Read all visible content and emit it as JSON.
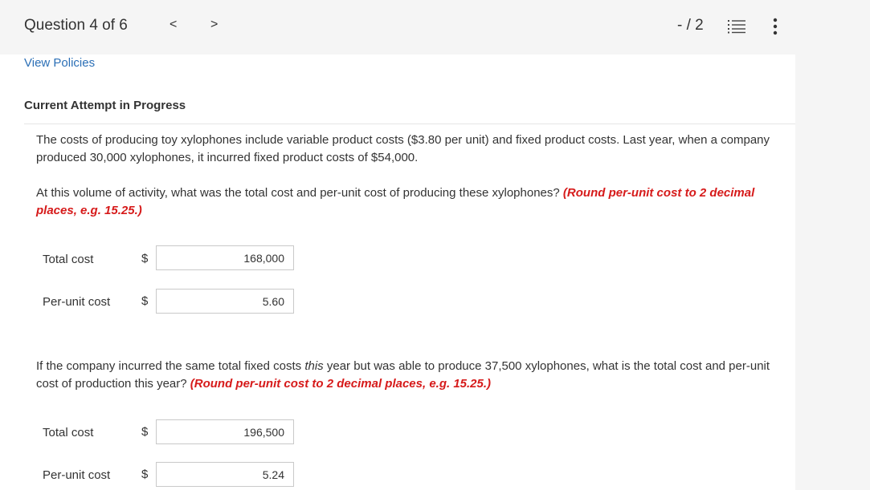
{
  "header": {
    "question_title": "Question 4 of 6",
    "prev_glyph": "<",
    "next_glyph": ">",
    "score": "- / 2",
    "list_icon": "list-icon",
    "more_icon": "more-vertical-icon"
  },
  "links": {
    "view_policies": "View Policies"
  },
  "attempt_label": "Current Attempt in Progress",
  "question": {
    "intro": "The costs of producing toy xylophones include variable product costs ($3.80 per unit) and fixed product costs. Last year, when a company produced 30,000 xylophones, it incurred fixed product costs of $54,000.",
    "part1_text": "At this volume of activity, what was the total cost and per-unit cost of producing these xylophones?",
    "part1_note": "(Round per-unit cost to 2 decimal places, e.g. 15.25.)",
    "part2_text_a": "If the company incurred the same total fixed costs",
    "part2_text_em": "this",
    "part2_text_b": "year but was able to produce 37,500 xylophones, what is the total cost and per-unit cost of production this year?",
    "part2_note": "(Round per-unit cost to 2 decimal places, e.g. 15.25.)"
  },
  "part1": [
    {
      "label": "Total cost",
      "currency": "$",
      "value": "168,000"
    },
    {
      "label": "Per-unit cost",
      "currency": "$",
      "value": "5.60"
    }
  ],
  "part2": [
    {
      "label": "Total cost",
      "currency": "$",
      "value": "196,500"
    },
    {
      "label": "Per-unit cost",
      "currency": "$",
      "value": "5.24"
    }
  ],
  "colors": {
    "link": "#2b6fb6",
    "instruction_red": "#d61a1a",
    "background": "#f5f5f5",
    "panel": "#ffffff"
  }
}
